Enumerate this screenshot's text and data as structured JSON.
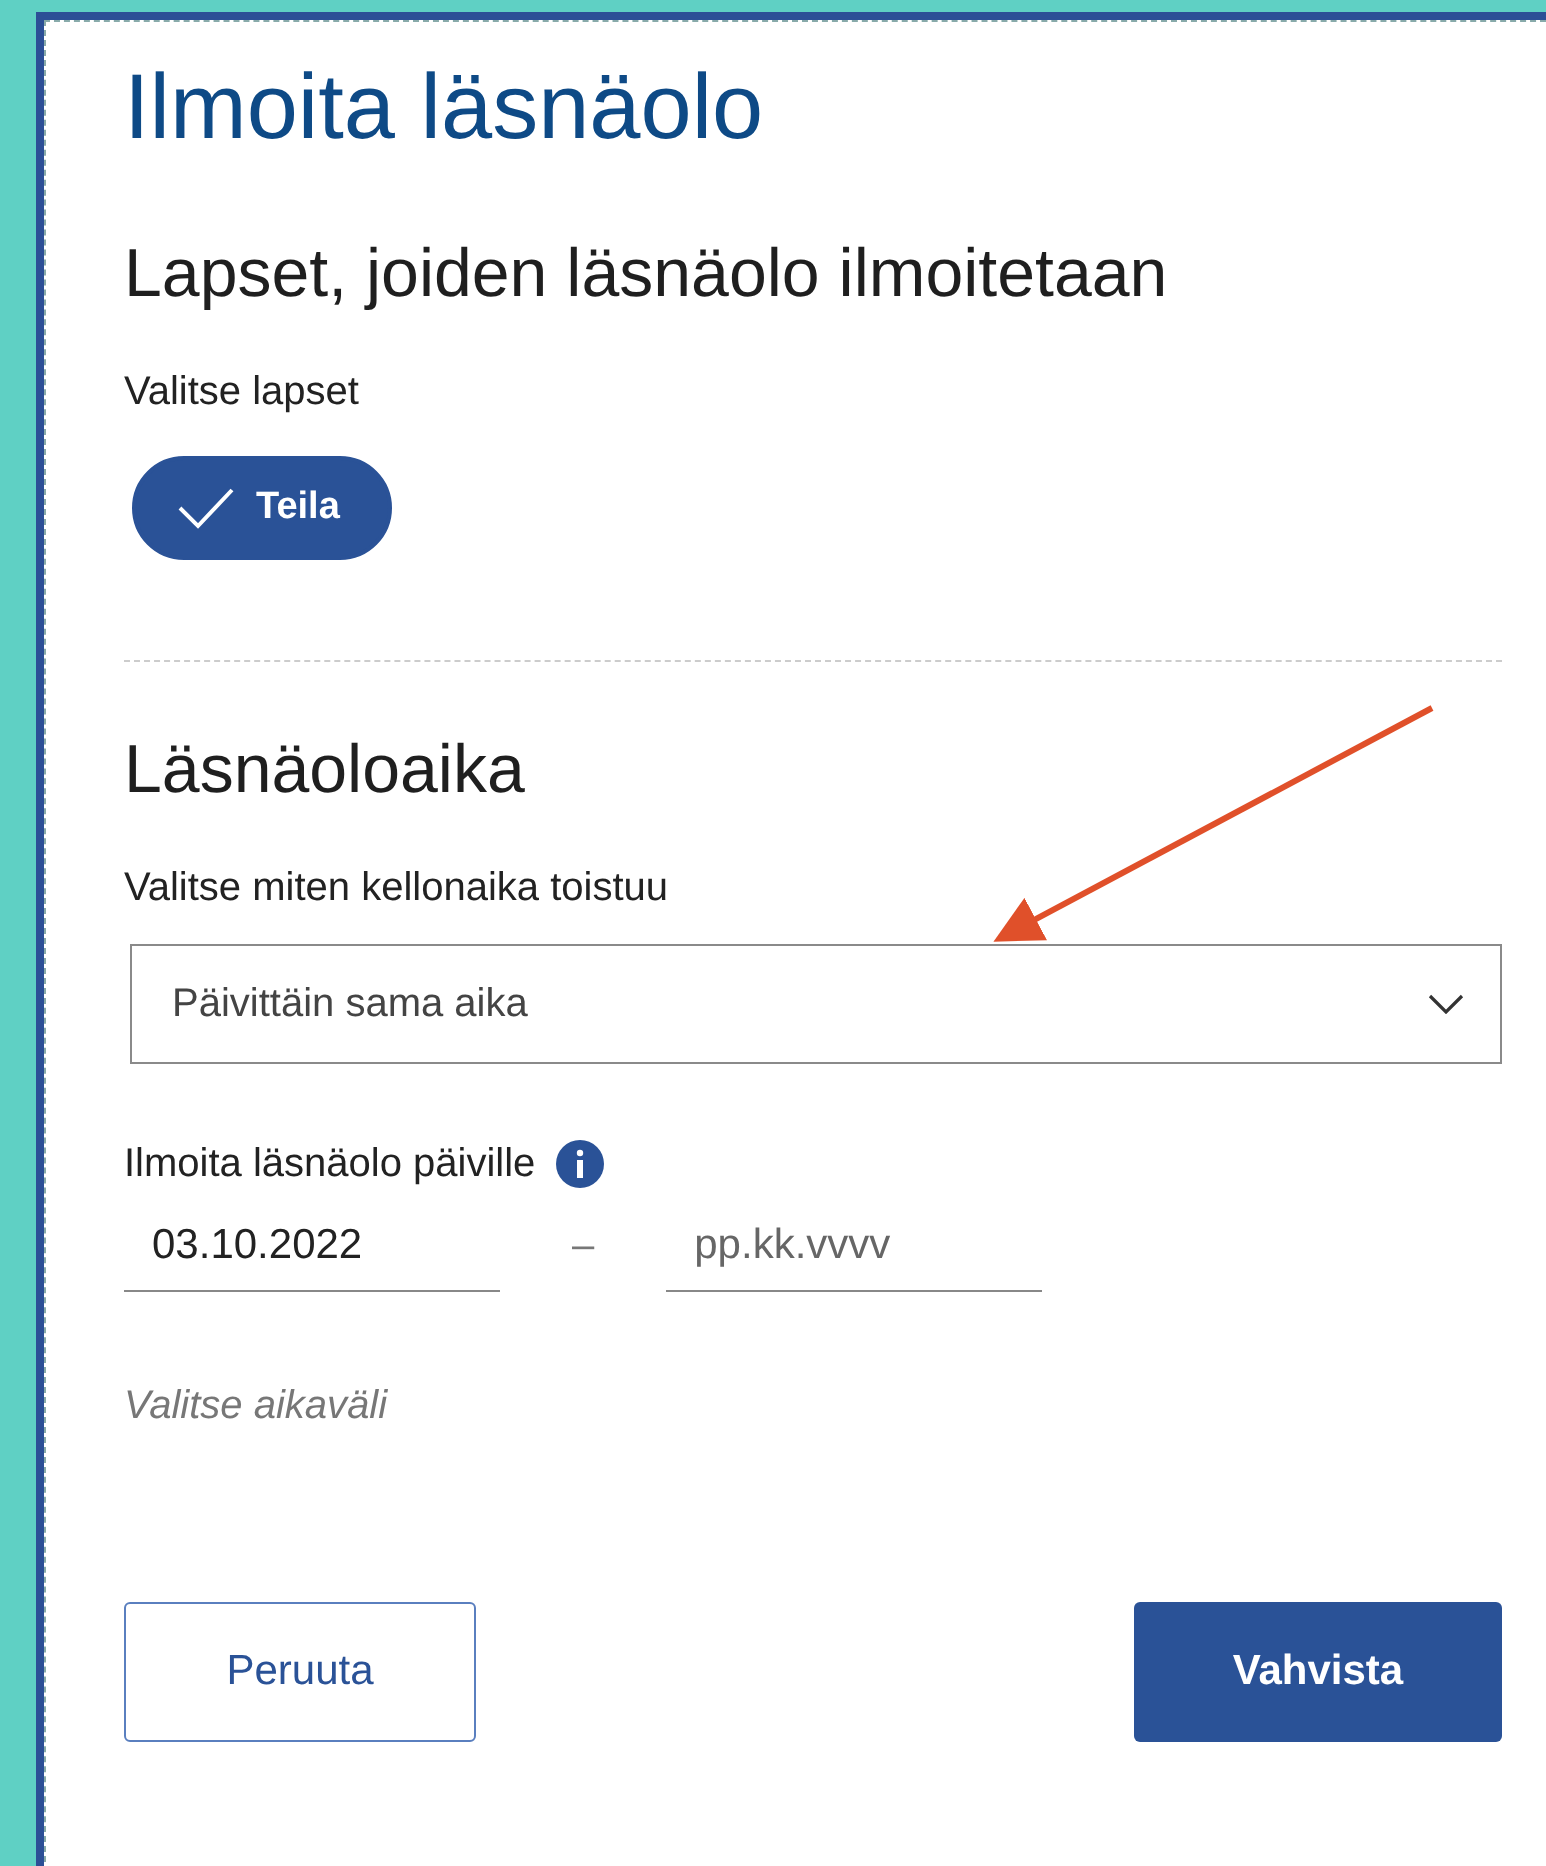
{
  "dialog": {
    "title": "Ilmoita läsnäolo"
  },
  "children_section": {
    "heading": "Lapset, joiden läsnäolo ilmoitetaan",
    "label": "Valitse lapset",
    "children": [
      {
        "name": "Teila",
        "selected": true
      }
    ]
  },
  "time_section": {
    "heading": "Läsnäoloaika",
    "repeat_label": "Valitse miten kellonaika toistuu",
    "repeat_value": "Päivittäin sama aika",
    "dates_label": "Ilmoita läsnäolo päiville",
    "start_date": "03.10.2022",
    "separator": "–",
    "end_placeholder": "pp.kk.vvvv",
    "hint": "Valitse aikaväli"
  },
  "buttons": [
    {
      "label": "Peruuta",
      "kind": "secondary"
    },
    {
      "label": "Vahvista",
      "kind": "primary"
    }
  ]
}
